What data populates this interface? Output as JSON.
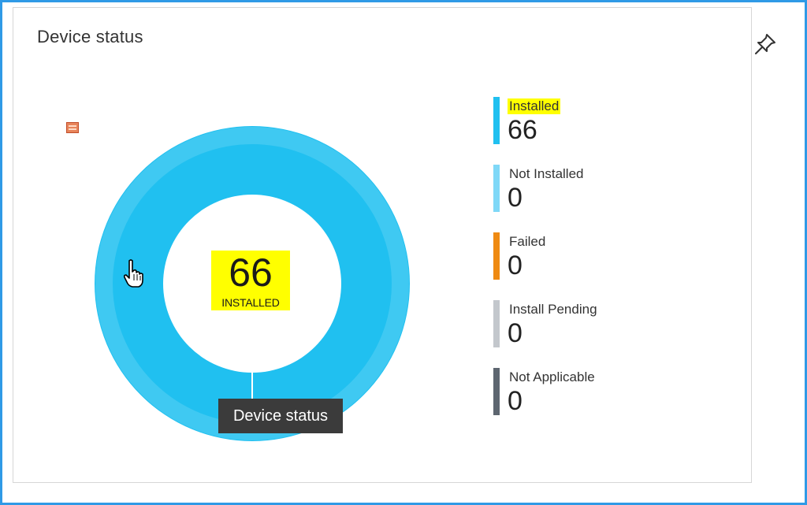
{
  "tile": {
    "title": "Device status"
  },
  "icons": {
    "pin": "pin-icon",
    "loader": "image-placeholder-icon",
    "cursor": "hand-pointer-cursor"
  },
  "colors": {
    "frame_border": "#2f9ae6",
    "installed": "#20c0f0",
    "not_installed": "#7fd8f7",
    "failed": "#ef8a12",
    "install_pending": "#c3c7cc",
    "not_applicable": "#5d6670",
    "highlight": "#ffff00",
    "tooltip_bg": "#3b3b3b"
  },
  "chart_data": {
    "type": "pie",
    "variant": "donut",
    "categories": [
      "Installed",
      "Not Installed",
      "Failed",
      "Install Pending",
      "Not Applicable"
    ],
    "values": [
      66,
      0,
      0,
      0,
      0
    ],
    "center_value": "66",
    "center_label": "INSTALLED",
    "legend_placement": "right",
    "tooltip": "Device status"
  },
  "legend": [
    {
      "label": "Installed",
      "value": "66",
      "color": "#20c0f0",
      "highlighted": true
    },
    {
      "label": "Not Installed",
      "value": "0",
      "color": "#7fd8f7",
      "highlighted": false
    },
    {
      "label": "Failed",
      "value": "0",
      "color": "#ef8a12",
      "highlighted": false
    },
    {
      "label": "Install Pending",
      "value": "0",
      "color": "#c3c7cc",
      "highlighted": false
    },
    {
      "label": "Not Applicable",
      "value": "0",
      "color": "#5d6670",
      "highlighted": false
    }
  ]
}
